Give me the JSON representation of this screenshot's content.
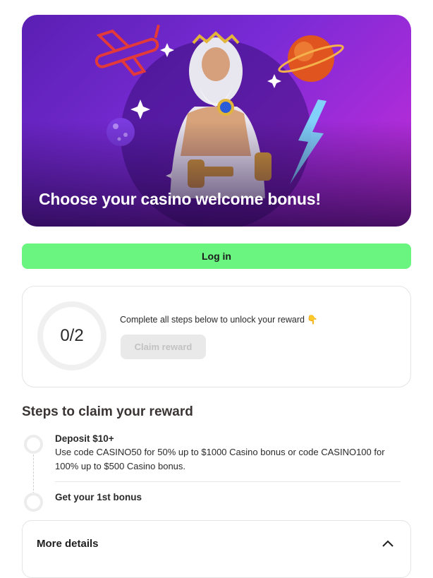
{
  "hero": {
    "title": "Choose your casino welcome bonus!"
  },
  "login": {
    "label": "Log in"
  },
  "progress": {
    "text": "0/2",
    "completed": 0,
    "total": 2,
    "message": "Complete all steps below to unlock your reward",
    "message_emoji": "👇",
    "claim_label": "Claim reward"
  },
  "steps": {
    "title": "Steps to claim your reward",
    "items": [
      {
        "title": "Deposit $10+",
        "description": "Use code CASINO50 for 50% up to $1000 Casino bonus or code CASINO100 for 100% up to $500 Casino bonus."
      },
      {
        "title": "Get your 1st bonus"
      }
    ]
  },
  "details": {
    "label": "More details"
  },
  "colors": {
    "accent_green": "#69f57f",
    "hero_purple": "#7a2bd6",
    "disabled_gray": "#e9e9e9"
  }
}
